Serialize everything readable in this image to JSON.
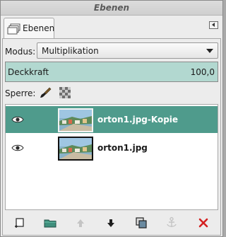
{
  "window": {
    "title": "Ebenen"
  },
  "tab": {
    "label": "Ebenen",
    "icon": "layers-icon"
  },
  "mode": {
    "label": "Modus:",
    "value": "Multiplikation"
  },
  "opacity": {
    "label": "Deckkraft",
    "value": "100,0"
  },
  "lock": {
    "label": "Sperre:"
  },
  "layers": [
    {
      "name": "orton1.jpg-Kopie",
      "visible": true,
      "selected": true
    },
    {
      "name": "orton1.jpg",
      "visible": true,
      "selected": false
    }
  ],
  "toolbar": {
    "buttons": [
      {
        "icon": "new-layer-icon",
        "enabled": true
      },
      {
        "icon": "new-layer-group-icon",
        "enabled": true
      },
      {
        "icon": "raise-layer-icon",
        "enabled": false
      },
      {
        "icon": "lower-layer-icon",
        "enabled": true
      },
      {
        "icon": "duplicate-layer-icon",
        "enabled": true
      },
      {
        "icon": "anchor-layer-icon",
        "enabled": false
      },
      {
        "icon": "delete-layer-icon",
        "enabled": true
      }
    ]
  },
  "colors": {
    "selection": "#4f9b8c",
    "opacity_bar": "#b2d8d0",
    "delete": "#d42020"
  }
}
